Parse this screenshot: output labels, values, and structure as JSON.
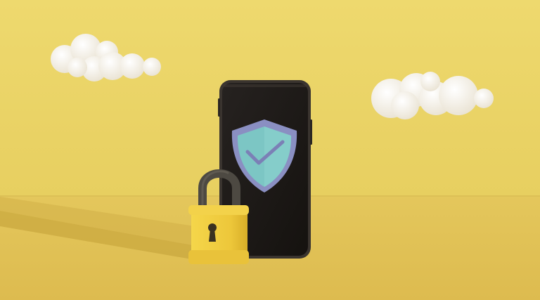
{
  "scene": {
    "colors": {
      "wall": "#ecd56a",
      "floor": "#e3c45a",
      "phone_body": "#2a2623",
      "phone_screen": "#1c1815",
      "shield_outer": "#7f86b9",
      "shield_inner": "#7fc8c6",
      "checkmark": "#7a80b5",
      "lock_body": "#f0cd3c",
      "lock_shackle": "#4e4a42",
      "cloud": "#f6f1e7"
    },
    "icons": [
      "cloud-icon",
      "smartphone-icon",
      "shield-check-icon",
      "padlock-icon",
      "keyhole-icon"
    ]
  }
}
